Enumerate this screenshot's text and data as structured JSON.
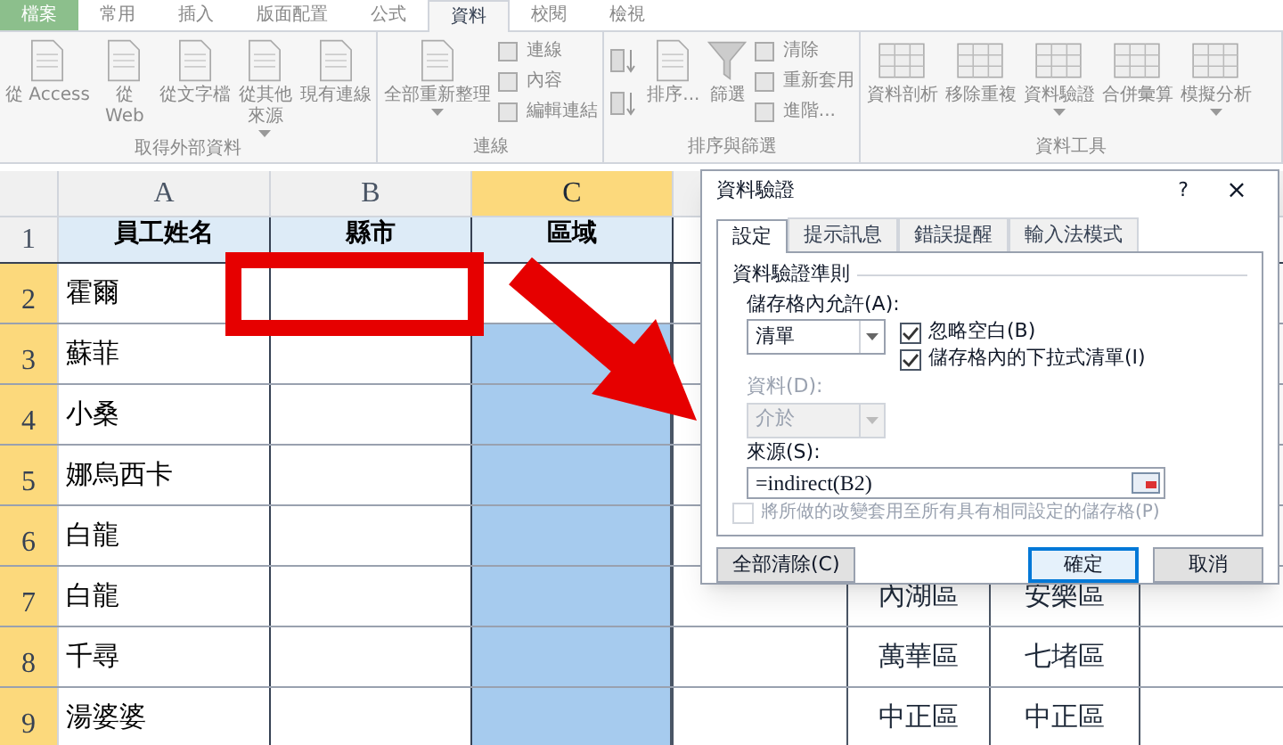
{
  "ribbon": {
    "tabs": [
      {
        "label": "檔案",
        "kind": "file",
        "selected": false
      },
      {
        "label": "常用",
        "kind": "tab",
        "selected": false
      },
      {
        "label": "插入",
        "kind": "tab",
        "selected": false
      },
      {
        "label": "版面配置",
        "kind": "tab",
        "selected": false
      },
      {
        "label": "公式",
        "kind": "tab",
        "selected": false
      },
      {
        "label": "資料",
        "kind": "tab",
        "selected": true
      },
      {
        "label": "校閱",
        "kind": "tab",
        "selected": false
      },
      {
        "label": "檢視",
        "kind": "tab",
        "selected": false
      }
    ],
    "groups": [
      {
        "label": "取得外部資料",
        "items": [
          {
            "kind": "large",
            "label": "從 Access"
          },
          {
            "kind": "large",
            "label": "從 Web"
          },
          {
            "kind": "large",
            "label": "從文字檔"
          },
          {
            "kind": "large",
            "label": "從其他來源",
            "dropdown": true
          },
          {
            "kind": "large",
            "label": "現有連線"
          }
        ]
      },
      {
        "label": "連線",
        "items": [
          {
            "kind": "large",
            "label": "全部重新整理",
            "dropdown": true
          },
          {
            "kind": "stack",
            "items": [
              "連線",
              "內容",
              "編輯連結"
            ]
          }
        ]
      },
      {
        "label": "排序與篩選",
        "items": [
          {
            "kind": "sort"
          },
          {
            "kind": "large",
            "label": "排序..."
          },
          {
            "kind": "filter",
            "label": "篩選"
          },
          {
            "kind": "stack",
            "items": [
              "清除",
              "重新套用",
              "進階..."
            ]
          }
        ]
      },
      {
        "label": "資料工具",
        "items": [
          {
            "kind": "tool",
            "label": "資料剖析"
          },
          {
            "kind": "tool",
            "label": "移除重複"
          },
          {
            "kind": "tool",
            "label": "資料驗證",
            "dropdown": true
          },
          {
            "kind": "tool",
            "label": "合併彙算"
          },
          {
            "kind": "tool",
            "label": "模擬分析",
            "dropdown": true
          }
        ]
      }
    ]
  },
  "sheet": {
    "columns": [
      {
        "label": "A",
        "selected": false
      },
      {
        "label": "B",
        "selected": false
      },
      {
        "label": "C",
        "selected": true
      }
    ],
    "header_row": {
      "number": "1",
      "selected": false,
      "cells": [
        "員工姓名",
        "縣市",
        "區域"
      ]
    },
    "rows": [
      {
        "number": "2",
        "selected": true,
        "name": "霍爾",
        "region_selected": false
      },
      {
        "number": "3",
        "selected": true,
        "name": "蘇菲",
        "region_selected": true
      },
      {
        "number": "4",
        "selected": true,
        "name": "小桑",
        "region_selected": true
      },
      {
        "number": "5",
        "selected": true,
        "name": "娜烏西卡",
        "region_selected": true
      },
      {
        "number": "6",
        "selected": true,
        "name": "白龍",
        "region_selected": true
      },
      {
        "number": "7",
        "selected": true,
        "name": "白龍",
        "region_selected": true,
        "side": [
          "內湖區",
          "安樂區"
        ]
      },
      {
        "number": "8",
        "selected": true,
        "name": "千尋",
        "region_selected": true,
        "side": [
          "萬華區",
          "七堵區"
        ]
      },
      {
        "number": "9",
        "selected": true,
        "name": "湯婆婆",
        "region_selected": true,
        "side": [
          "中正區",
          "中正區"
        ]
      }
    ]
  },
  "dialog": {
    "title": "資料驗證",
    "help": "?",
    "close": "×",
    "tabs": [
      {
        "label": "設定",
        "selected": true
      },
      {
        "label": "提示訊息",
        "selected": false
      },
      {
        "label": "錯誤提醒",
        "selected": false
      },
      {
        "label": "輸入法模式",
        "selected": false
      }
    ],
    "group_label": "資料驗證準則",
    "allow_label": "儲存格內允許(A):",
    "allow_value": "清單",
    "options": [
      {
        "label": "忽略空白(B)",
        "checked": true
      },
      {
        "label": "儲存格內的下拉式清單(I)",
        "checked": true
      }
    ],
    "data_label": "資料(D):",
    "data_value": "介於",
    "data_disabled": true,
    "source_label": "來源(S):",
    "source_value": "=indirect(B2)",
    "apply_all": {
      "label": "將所做的改變套用至所有具有相同設定的儲存格(P)",
      "checked": false,
      "disabled": true
    },
    "buttons": [
      {
        "label": "全部清除(C)",
        "kind": "default"
      },
      {
        "label": "確定",
        "kind": "primary"
      },
      {
        "label": "取消",
        "kind": "default"
      }
    ]
  }
}
